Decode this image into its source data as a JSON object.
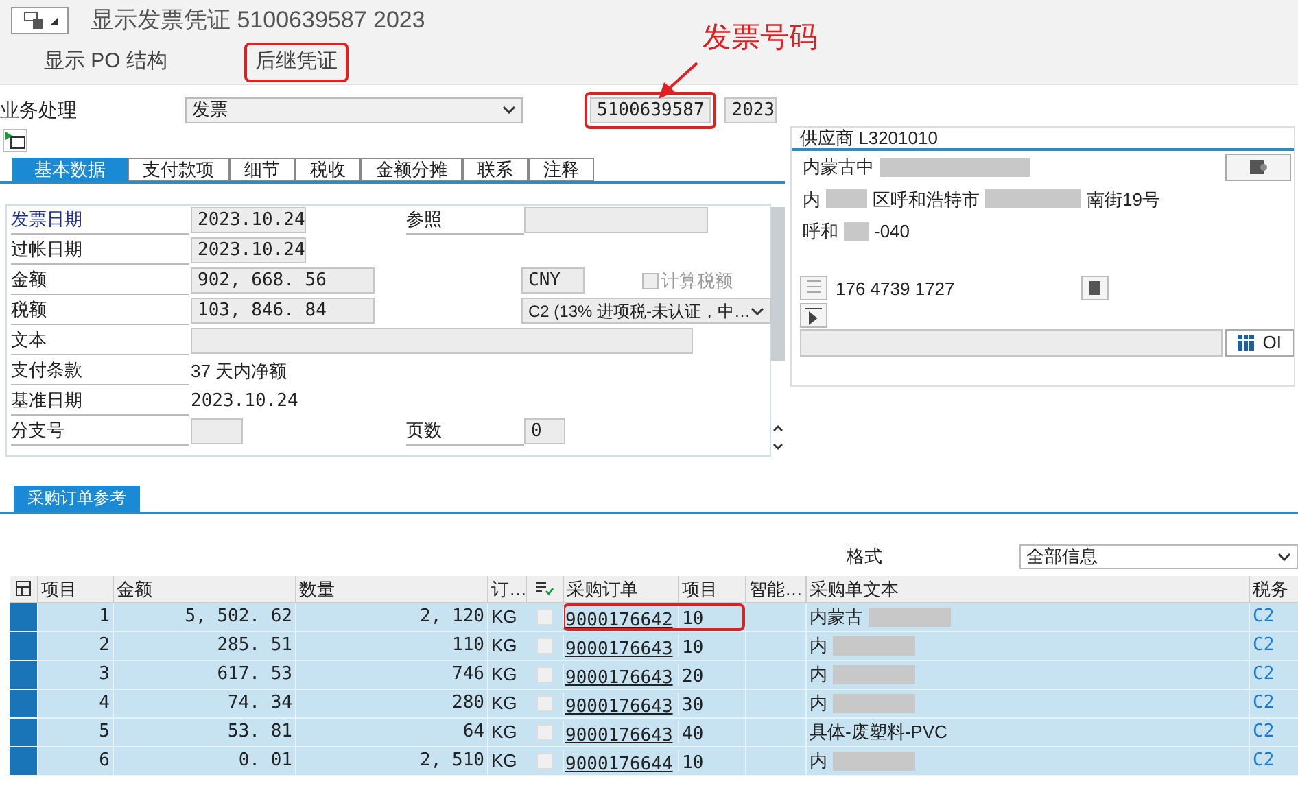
{
  "window": {
    "title": "显示发票凭证 5100639587 2023"
  },
  "toolbar": [
    {
      "label": "显示 PO 结构",
      "highlighted": false
    },
    {
      "label": "后继凭证",
      "highlighted": true
    }
  ],
  "annotation": {
    "label": "发票号码"
  },
  "transaction": {
    "label": "业务处理",
    "value": "发票",
    "document_number": "5100639587",
    "year": "2023"
  },
  "tabs": [
    {
      "label": "基本数据",
      "selected": true
    },
    {
      "label": "支付款项",
      "selected": false
    },
    {
      "label": "细节",
      "selected": false
    },
    {
      "label": "税收",
      "selected": false
    },
    {
      "label": "金额分摊",
      "selected": false
    },
    {
      "label": "联系",
      "selected": false
    },
    {
      "label": "注释",
      "selected": false
    }
  ],
  "form": [
    {
      "label": "发票日期",
      "value": "2023.10.24",
      "kind": "date",
      "right": {
        "kind": "wide",
        "label": "参照"
      }
    },
    {
      "label": "过帐日期",
      "value": "2023.10.24",
      "kind": "date"
    },
    {
      "label": "金额",
      "value": "902, 668. 56",
      "kind": "amount",
      "right": {
        "kind": "currency",
        "value": "CNY"
      },
      "extra": "计算税额",
      "extra_checked": false
    },
    {
      "label": "税额",
      "value": "103, 846. 84",
      "kind": "amount",
      "right": {
        "kind": "select",
        "value": "C2 (13% 进项税-未认证，中…"
      }
    },
    {
      "label": "文本",
      "kind": "long"
    },
    {
      "label": "支付条款",
      "value": "37 天内净额",
      "kind": "text"
    },
    {
      "label": "基准日期",
      "value": "2023.10.24",
      "kind": "text"
    },
    {
      "label": "分支号",
      "kind": "short",
      "right": {
        "kind": "short",
        "label": "页数",
        "value": "0"
      }
    }
  ],
  "vendor": {
    "title": "供应商 L3201010",
    "lines": [
      "内蒙古中",
      "内",
      "区呼和浩特市",
      "南街19号",
      "呼和",
      "-040"
    ],
    "phone": "176 4739 1727",
    "button": "OI"
  },
  "section_tab": {
    "label": "采购订单参考"
  },
  "layout": {
    "label": "格式",
    "value": "全部信息"
  },
  "table": {
    "columns": [
      "项目",
      "金额",
      "数量",
      "订…",
      "采购订单",
      "项目",
      "智能…",
      "采购单文本",
      "税务"
    ],
    "rows": [
      {
        "item": "1",
        "amount": "5, 502. 62",
        "qty": "2, 120",
        "unit": "KG",
        "po": "9000176642",
        "po_item": "10",
        "text": "内蒙古",
        "tax": "C2",
        "checked": false,
        "highlighted": true
      },
      {
        "item": "2",
        "amount": "285. 51",
        "qty": "110",
        "unit": "KG",
        "po": "9000176643",
        "po_item": "10",
        "text": "内",
        "tax": "C2",
        "checked": false,
        "highlighted": false
      },
      {
        "item": "3",
        "amount": "617. 53",
        "qty": "746",
        "unit": "KG",
        "po": "9000176643",
        "po_item": "20",
        "text": "内",
        "tax": "C2",
        "checked": false,
        "highlighted": false
      },
      {
        "item": "4",
        "amount": "74. 34",
        "qty": "280",
        "unit": "KG",
        "po": "9000176643",
        "po_item": "30",
        "text": "内",
        "tax": "C2",
        "checked": false,
        "highlighted": false
      },
      {
        "item": "5",
        "amount": "53. 81",
        "qty": "64",
        "unit": "KG",
        "po": "9000176643",
        "po_item": "40",
        "text": "具体-废塑料-PVC",
        "tax": "C2",
        "checked": false,
        "highlighted": false
      },
      {
        "item": "6",
        "amount": "0. 01",
        "qty": "2, 510",
        "unit": "KG",
        "po": "9000176644",
        "po_item": "10",
        "text": "内",
        "tax": "C2",
        "checked": false,
        "highlighted": false
      }
    ]
  }
}
